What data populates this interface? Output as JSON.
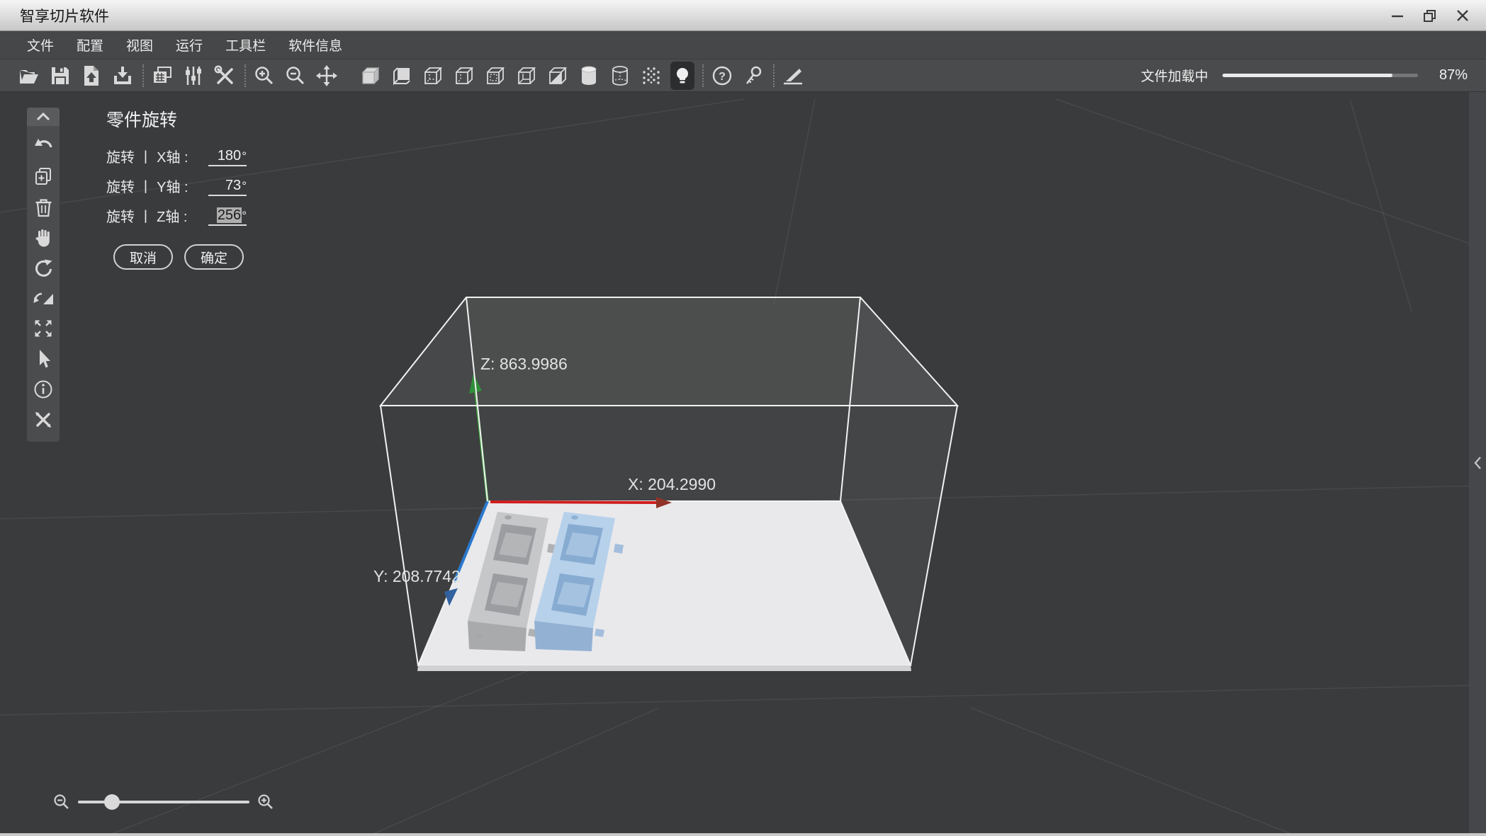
{
  "window": {
    "title": "智享切片软件",
    "controls": {
      "minimize": "minimize",
      "restore": "restore",
      "close": "close"
    }
  },
  "menubar": {
    "items": [
      {
        "label": "文件"
      },
      {
        "label": "配置"
      },
      {
        "label": "视图"
      },
      {
        "label": "运行"
      },
      {
        "label": "工具栏"
      },
      {
        "label": "软件信息"
      }
    ]
  },
  "toolbar": {
    "icons": [
      "open-file",
      "save-file",
      "import-model",
      "export-file",
      "copy-plate",
      "parameter-sliders",
      "tools",
      "zoom-in",
      "zoom-out",
      "move",
      "view-solid",
      "view-backface",
      "view-wireframe-1",
      "view-wireframe-2",
      "view-wireframe-3",
      "view-open-box",
      "view-section",
      "cylinder-solid",
      "cylinder-wireframe",
      "point-cloud",
      "light-toggle",
      "help",
      "license-key",
      "slice-knife"
    ],
    "active_icon": "light-toggle",
    "progress_label": "文件加载中",
    "progress_percent": 87,
    "progress_text": "87%"
  },
  "left_toolbar": {
    "icons": [
      "collapse-up",
      "undo",
      "duplicate",
      "delete",
      "pan-hand",
      "rotate-ccw",
      "mirror",
      "fit-view",
      "select-cursor",
      "info",
      "repair-tools"
    ]
  },
  "rotation_panel": {
    "title": "零件旋转",
    "rows": [
      {
        "label": "旋转 丨 X轴 :",
        "value": "180",
        "unit": "°"
      },
      {
        "label": "旋转 丨 Y轴 :",
        "value": "73",
        "unit": "°"
      },
      {
        "label": "旋转 丨 Z轴 :",
        "value": "256",
        "unit": "°"
      }
    ],
    "selected_row": 2,
    "cancel_label": "取消",
    "confirm_label": "确定"
  },
  "viewport": {
    "axis_labels": {
      "z": "Z:  863.9986",
      "x": "X: 204.2990",
      "y": "Y:  208.7742"
    },
    "axis_colors": {
      "x": "#cf1d1d",
      "y": "#2b79cf",
      "z": "#3fa23f"
    },
    "models": [
      {
        "name": "mold-gray",
        "color": "#c6c7c9"
      },
      {
        "name": "mold-blue",
        "color": "#b7d1eb",
        "selected": true
      }
    ]
  },
  "zoom_control": {
    "position_percent": 20
  },
  "right_edge": {
    "chevron": "‹"
  }
}
